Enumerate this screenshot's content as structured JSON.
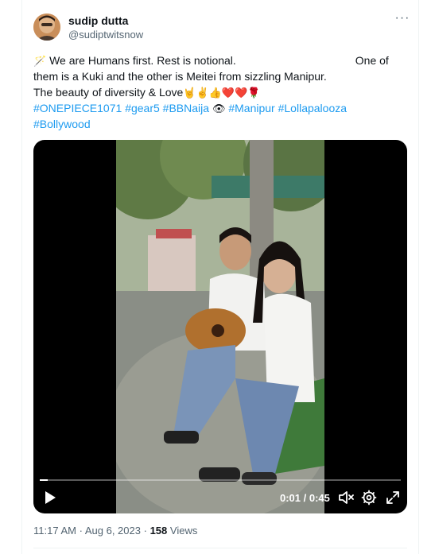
{
  "author": {
    "name": "sudip dutta",
    "handle": "@sudiptwitsnow",
    "more_icon": "ellipsis-icon",
    "more_label": "···"
  },
  "tweet": {
    "line1_emoji": "🪄",
    "line1_text": "We are Humans first. Rest is notional.",
    "line1_tail": "One of",
    "line2_text": "them is a Kuki and the other is Meitei from sizzling Manipur.",
    "line3_text": "The beauty of diversity & Love",
    "line3_emojis": "🤘✌️👍❤️❤️🌹",
    "hashtags_line4": [
      "#ONEPIECE1071",
      "#gear5",
      "#BBNaija"
    ],
    "line4_emoji": "👁",
    "hashtags_line4b": [
      "#Manipur",
      "#Lollapalooza"
    ],
    "hashtags_line5": [
      "#Bollywood"
    ]
  },
  "video": {
    "time": "0:01 / 0:45",
    "progress": 0.022,
    "controls": [
      "play-icon",
      "mute-icon",
      "settings-icon",
      "fullscreen-icon"
    ]
  },
  "meta": {
    "time": "11:17 AM",
    "separator1": "·",
    "date": "Aug 6, 2023",
    "separator2": "·",
    "views_count": "158",
    "views_label": "Views"
  },
  "colors": {
    "link": "#1d9bf0",
    "secondary_text": "#536471",
    "media_background": "#000000"
  }
}
